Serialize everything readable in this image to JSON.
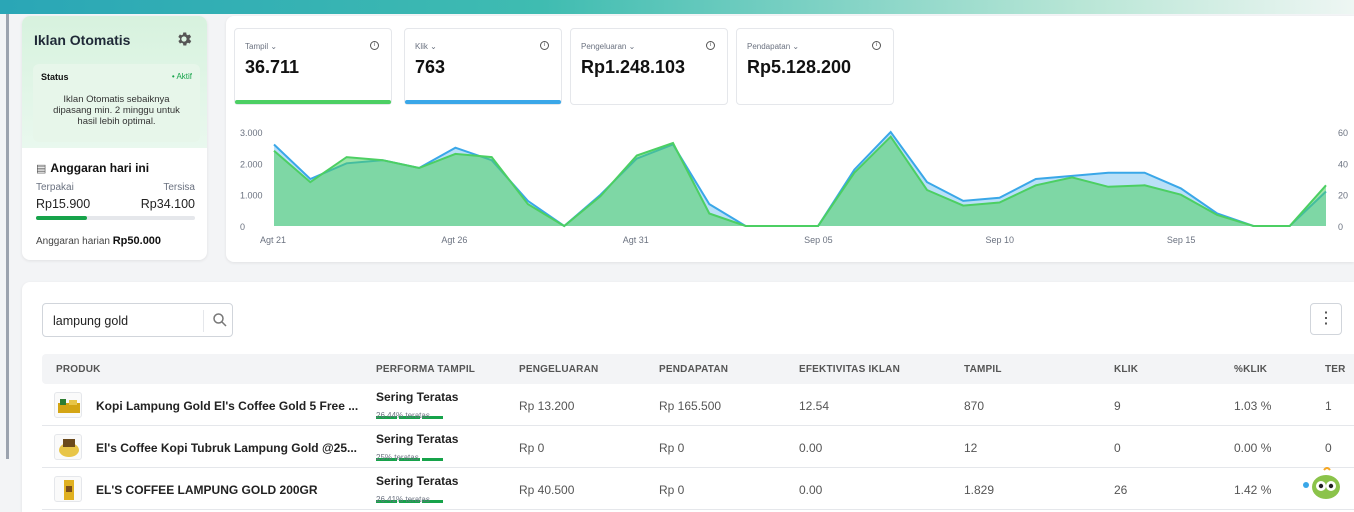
{
  "sidebar_card": {
    "title": "Iklan Otomatis",
    "status_label": "Status",
    "status_value": "• Aktif",
    "status_note": "Iklan Otomatis sebaiknya dipasang min. 2 minggu untuk hasil lebih optimal.",
    "budget_title": "Anggaran hari ini",
    "used_label": "Terpakai",
    "remaining_label": "Tersisa",
    "used_value": "Rp15.900",
    "remaining_value": "Rp34.100",
    "used_fraction": 0.318,
    "daily_budget_label": "Anggaran harian",
    "daily_budget_value": "Rp50.000"
  },
  "metrics": [
    {
      "label": "Tampil ⌄",
      "value": "36.711",
      "selected": true,
      "color": "#4ccf63"
    },
    {
      "label": "Klik ⌄",
      "value": "763",
      "selected": true,
      "color": "#3aa7e8"
    },
    {
      "label": "Pengeluaran ⌄",
      "value": "Rp1.248.103",
      "selected": false
    },
    {
      "label": "Pendapatan ⌄",
      "value": "Rp5.128.200",
      "selected": false
    }
  ],
  "chart_data": {
    "type": "area",
    "x": [
      "Agt 21",
      "Agt 22",
      "Agt 23",
      "Agt 24",
      "Agt 25",
      "Agt 26",
      "Agt 27",
      "Agt 28",
      "Agt 29",
      "Agt 30",
      "Agt 31",
      "Sep 01",
      "Sep 02",
      "Sep 03",
      "Sep 04",
      "Sep 05",
      "Sep 06",
      "Sep 07",
      "Sep 08",
      "Sep 09",
      "Sep 10",
      "Sep 11",
      "Sep 12",
      "Sep 13",
      "Sep 14",
      "Sep 15",
      "Sep 16",
      "Sep 17",
      "Sep 18"
    ],
    "x_tick_labels": [
      "Agt 21",
      "Agt 26",
      "Agt 31",
      "Sep 05",
      "Sep 10",
      "Sep 15"
    ],
    "series": [
      {
        "axis": "left",
        "color": "#4ccf63",
        "values": [
          2400,
          1400,
          2200,
          2100,
          1850,
          2300,
          2200,
          700,
          0,
          950,
          2250,
          2650,
          400,
          0,
          0,
          0,
          1700,
          2850,
          1150,
          650,
          750,
          1300,
          1550,
          1250,
          1300,
          1000,
          350,
          0,
          0,
          1300
        ]
      },
      {
        "axis": "right",
        "color": "#3aa7e8",
        "values": [
          52,
          30,
          40,
          42,
          37,
          50,
          42,
          16,
          0,
          20,
          43,
          52,
          14,
          0,
          0,
          0,
          36,
          60,
          28,
          16,
          18,
          30,
          32,
          34,
          34,
          24,
          8,
          0,
          0,
          22
        ]
      }
    ],
    "y_left": {
      "ticks": [
        "3.000",
        "2.000",
        "1.000",
        "0"
      ],
      "range": [
        0,
        3000
      ]
    },
    "y_right": {
      "ticks": [
        "60",
        "40",
        "20",
        "0"
      ],
      "range": [
        0,
        60
      ]
    },
    "grid": false
  },
  "table": {
    "search_value": "lampung gold",
    "columns": [
      "PRODUK",
      "PERFORMA TAMPIL",
      "PENGELUARAN",
      "PENDAPATAN",
      "EFEKTIVITAS IKLAN",
      "TAMPIL",
      "KLIK",
      "%KLIK",
      "TER"
    ],
    "rows": [
      {
        "name": "Kopi Lampung Gold El's Coffee Gold 5 Free ...",
        "perf": "Sering Teratas",
        "perf_sub": "26.44% teratas",
        "spend": "Rp 13.200",
        "revenue": "Rp 165.500",
        "effect": "12.54",
        "views": "870",
        "clicks": "9",
        "ctr": "1.03 %",
        "ter": "1"
      },
      {
        "name": "El's Coffee Kopi Tubruk Lampung Gold @25...",
        "perf": "Sering Teratas",
        "perf_sub": "25% teratas",
        "spend": "Rp 0",
        "revenue": "Rp 0",
        "effect": "0.00",
        "views": "12",
        "clicks": "0",
        "ctr": "0.00 %",
        "ter": "0"
      },
      {
        "name": "EL'S COFFEE LAMPUNG GOLD 200GR",
        "perf": "Sering Teratas",
        "perf_sub": "26.41% teratas",
        "spend": "Rp 40.500",
        "revenue": "Rp 0",
        "effect": "0.00",
        "views": "1.829",
        "clicks": "26",
        "ctr": "1.42 %",
        "ter": ""
      }
    ]
  }
}
